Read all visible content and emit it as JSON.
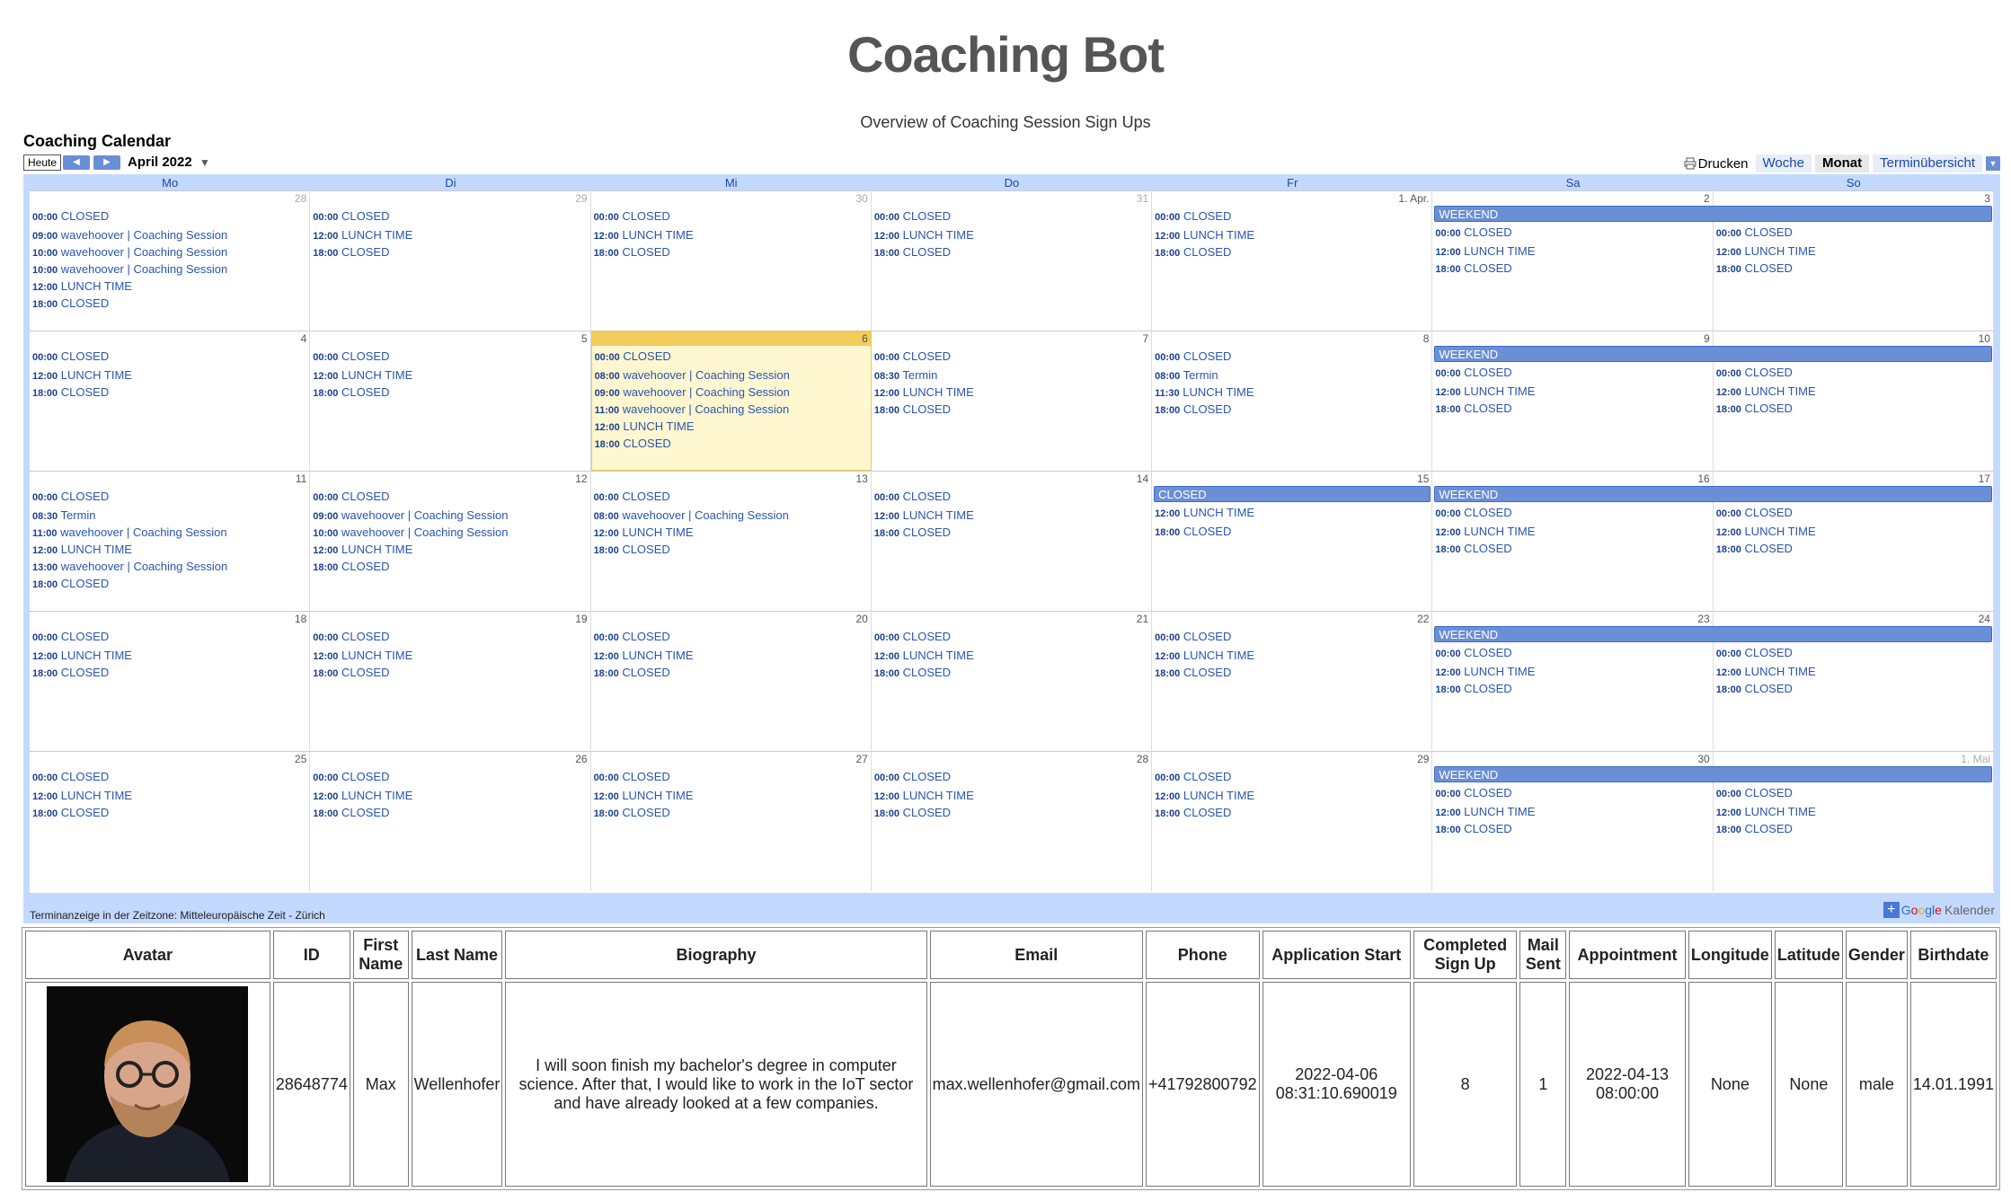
{
  "page": {
    "title": "Coaching Bot",
    "subtitle": "Overview of Coaching Session Sign Ups",
    "calendar_title": "Coaching Calendar"
  },
  "toolbar": {
    "today": "Heute",
    "month": "April 2022",
    "print": "Drucken",
    "views": [
      "Woche",
      "Monat",
      "Terminübersicht"
    ],
    "active_view": "Monat"
  },
  "calendar": {
    "day_names": [
      "Mo",
      "Di",
      "Mi",
      "Do",
      "Fr",
      "Sa",
      "So"
    ],
    "footer": "Terminanzeige in der Zeitzone: Mitteleuropäische Zeit - Zürich",
    "brand": "Kalender",
    "weeks": [
      {
        "dates": [
          "28",
          "29",
          "30",
          "31",
          "1. Apr.",
          "2",
          "3"
        ],
        "other_month": [
          true,
          true,
          true,
          true,
          false,
          false,
          false
        ],
        "weekend_bar": "WEEKEND",
        "events": [
          [
            [
              "00:00",
              "CLOSED"
            ],
            [
              "09:00",
              "wavehoover | Coaching Session"
            ],
            [
              "10:00",
              "wavehoover | Coaching Session"
            ],
            [
              "10:00",
              "wavehoover | Coaching Session"
            ],
            [
              "12:00",
              "LUNCH TIME"
            ],
            [
              "18:00",
              "CLOSED"
            ]
          ],
          [
            [
              "00:00",
              "CLOSED"
            ],
            [
              "12:00",
              "LUNCH TIME"
            ],
            [
              "18:00",
              "CLOSED"
            ]
          ],
          [
            [
              "00:00",
              "CLOSED"
            ],
            [
              "12:00",
              "LUNCH TIME"
            ],
            [
              "18:00",
              "CLOSED"
            ]
          ],
          [
            [
              "00:00",
              "CLOSED"
            ],
            [
              "12:00",
              "LUNCH TIME"
            ],
            [
              "18:00",
              "CLOSED"
            ]
          ],
          [
            [
              "00:00",
              "CLOSED"
            ],
            [
              "12:00",
              "LUNCH TIME"
            ],
            [
              "18:00",
              "CLOSED"
            ]
          ],
          [
            [
              "00:00",
              "CLOSED"
            ],
            [
              "12:00",
              "LUNCH TIME"
            ],
            [
              "18:00",
              "CLOSED"
            ]
          ],
          [
            [
              "00:00",
              "CLOSED"
            ],
            [
              "12:00",
              "LUNCH TIME"
            ],
            [
              "18:00",
              "CLOSED"
            ]
          ]
        ]
      },
      {
        "dates": [
          "4",
          "5",
          "6",
          "7",
          "8",
          "9",
          "10"
        ],
        "other_month": [
          false,
          false,
          false,
          false,
          false,
          false,
          false
        ],
        "today_index": 2,
        "weekend_bar": "WEEKEND",
        "events": [
          [
            [
              "00:00",
              "CLOSED"
            ],
            [
              "12:00",
              "LUNCH TIME"
            ],
            [
              "18:00",
              "CLOSED"
            ]
          ],
          [
            [
              "00:00",
              "CLOSED"
            ],
            [
              "12:00",
              "LUNCH TIME"
            ],
            [
              "18:00",
              "CLOSED"
            ]
          ],
          [
            [
              "00:00",
              "CLOSED"
            ],
            [
              "08:00",
              "wavehoover | Coaching Session"
            ],
            [
              "09:00",
              "wavehoover | Coaching Session"
            ],
            [
              "11:00",
              "wavehoover | Coaching Session"
            ],
            [
              "12:00",
              "LUNCH TIME"
            ],
            [
              "18:00",
              "CLOSED"
            ]
          ],
          [
            [
              "00:00",
              "CLOSED"
            ],
            [
              "08:30",
              "Termin"
            ],
            [
              "12:00",
              "LUNCH TIME"
            ],
            [
              "18:00",
              "CLOSED"
            ]
          ],
          [
            [
              "00:00",
              "CLOSED"
            ],
            [
              "08:00",
              "Termin"
            ],
            [
              "11:30",
              "LUNCH TIME"
            ],
            [
              "18:00",
              "CLOSED"
            ]
          ],
          [
            [
              "00:00",
              "CLOSED"
            ],
            [
              "12:00",
              "LUNCH TIME"
            ],
            [
              "18:00",
              "CLOSED"
            ]
          ],
          [
            [
              "00:00",
              "CLOSED"
            ],
            [
              "12:00",
              "LUNCH TIME"
            ],
            [
              "18:00",
              "CLOSED"
            ]
          ]
        ]
      },
      {
        "dates": [
          "11",
          "12",
          "13",
          "14",
          "15",
          "16",
          "17"
        ],
        "other_month": [
          false,
          false,
          false,
          false,
          false,
          false,
          false
        ],
        "weekend_bar": "WEEKEND",
        "friday_bar": "CLOSED",
        "events": [
          [
            [
              "00:00",
              "CLOSED"
            ],
            [
              "08:30",
              "Termin"
            ],
            [
              "11:00",
              "wavehoover | Coaching Session"
            ],
            [
              "12:00",
              "LUNCH TIME"
            ],
            [
              "13:00",
              "wavehoover | Coaching Session"
            ],
            [
              "18:00",
              "CLOSED"
            ]
          ],
          [
            [
              "00:00",
              "CLOSED"
            ],
            [
              "09:00",
              "wavehoover | Coaching Session"
            ],
            [
              "10:00",
              "wavehoover | Coaching Session"
            ],
            [
              "12:00",
              "LUNCH TIME"
            ],
            [
              "18:00",
              "CLOSED"
            ]
          ],
          [
            [
              "00:00",
              "CLOSED"
            ],
            [
              "08:00",
              "wavehoover | Coaching Session"
            ],
            [
              "12:00",
              "LUNCH TIME"
            ],
            [
              "18:00",
              "CLOSED"
            ]
          ],
          [
            [
              "00:00",
              "CLOSED"
            ],
            [
              "12:00",
              "LUNCH TIME"
            ],
            [
              "18:00",
              "CLOSED"
            ]
          ],
          [
            [
              "12:00",
              "LUNCH TIME"
            ],
            [
              "18:00",
              "CLOSED"
            ]
          ],
          [
            [
              "00:00",
              "CLOSED"
            ],
            [
              "12:00",
              "LUNCH TIME"
            ],
            [
              "18:00",
              "CLOSED"
            ]
          ],
          [
            [
              "00:00",
              "CLOSED"
            ],
            [
              "12:00",
              "LUNCH TIME"
            ],
            [
              "18:00",
              "CLOSED"
            ]
          ]
        ]
      },
      {
        "dates": [
          "18",
          "19",
          "20",
          "21",
          "22",
          "23",
          "24"
        ],
        "other_month": [
          false,
          false,
          false,
          false,
          false,
          false,
          false
        ],
        "weekend_bar": "WEEKEND",
        "events": [
          [
            [
              "00:00",
              "CLOSED"
            ],
            [
              "12:00",
              "LUNCH TIME"
            ],
            [
              "18:00",
              "CLOSED"
            ]
          ],
          [
            [
              "00:00",
              "CLOSED"
            ],
            [
              "12:00",
              "LUNCH TIME"
            ],
            [
              "18:00",
              "CLOSED"
            ]
          ],
          [
            [
              "00:00",
              "CLOSED"
            ],
            [
              "12:00",
              "LUNCH TIME"
            ],
            [
              "18:00",
              "CLOSED"
            ]
          ],
          [
            [
              "00:00",
              "CLOSED"
            ],
            [
              "12:00",
              "LUNCH TIME"
            ],
            [
              "18:00",
              "CLOSED"
            ]
          ],
          [
            [
              "00:00",
              "CLOSED"
            ],
            [
              "12:00",
              "LUNCH TIME"
            ],
            [
              "18:00",
              "CLOSED"
            ]
          ],
          [
            [
              "00:00",
              "CLOSED"
            ],
            [
              "12:00",
              "LUNCH TIME"
            ],
            [
              "18:00",
              "CLOSED"
            ]
          ],
          [
            [
              "00:00",
              "CLOSED"
            ],
            [
              "12:00",
              "LUNCH TIME"
            ],
            [
              "18:00",
              "CLOSED"
            ]
          ]
        ]
      },
      {
        "dates": [
          "25",
          "26",
          "27",
          "28",
          "29",
          "30",
          "1. Mai"
        ],
        "other_month": [
          false,
          false,
          false,
          false,
          false,
          false,
          true
        ],
        "weekend_bar": "WEEKEND",
        "events": [
          [
            [
              "00:00",
              "CLOSED"
            ],
            [
              "12:00",
              "LUNCH TIME"
            ],
            [
              "18:00",
              "CLOSED"
            ]
          ],
          [
            [
              "00:00",
              "CLOSED"
            ],
            [
              "12:00",
              "LUNCH TIME"
            ],
            [
              "18:00",
              "CLOSED"
            ]
          ],
          [
            [
              "00:00",
              "CLOSED"
            ],
            [
              "12:00",
              "LUNCH TIME"
            ],
            [
              "18:00",
              "CLOSED"
            ]
          ],
          [
            [
              "00:00",
              "CLOSED"
            ],
            [
              "12:00",
              "LUNCH TIME"
            ],
            [
              "18:00",
              "CLOSED"
            ]
          ],
          [
            [
              "00:00",
              "CLOSED"
            ],
            [
              "12:00",
              "LUNCH TIME"
            ],
            [
              "18:00",
              "CLOSED"
            ]
          ],
          [
            [
              "00:00",
              "CLOSED"
            ],
            [
              "12:00",
              "LUNCH TIME"
            ],
            [
              "18:00",
              "CLOSED"
            ]
          ],
          [
            [
              "00:00",
              "CLOSED"
            ],
            [
              "12:00",
              "LUNCH TIME"
            ],
            [
              "18:00",
              "CLOSED"
            ]
          ]
        ]
      }
    ]
  },
  "table": {
    "headers": [
      "Avatar",
      "ID",
      "First Name",
      "Last Name",
      "Biography",
      "Email",
      "Phone",
      "Application Start",
      "Completed Sign Up",
      "Mail Sent",
      "Appointment",
      "Longitude",
      "Latitude",
      "Gender",
      "Birthdate"
    ],
    "rows": [
      {
        "id": "28648774",
        "first_name": "Max",
        "last_name": "Wellenhofer",
        "biography": "I will soon finish my bachelor's degree in computer science. After that, I would like to work in the IoT sector and have already looked at a few companies.",
        "email": "max.wellenhofer@gmail.com",
        "phone": "+41792800792",
        "application_start": "2022-04-06 08:31:10.690019",
        "completed_sign_up": "8",
        "mail_sent": "1",
        "appointment": "2022-04-13 08:00:00",
        "longitude": "None",
        "latitude": "None",
        "gender": "male",
        "birthdate": "14.01.1991"
      }
    ]
  }
}
